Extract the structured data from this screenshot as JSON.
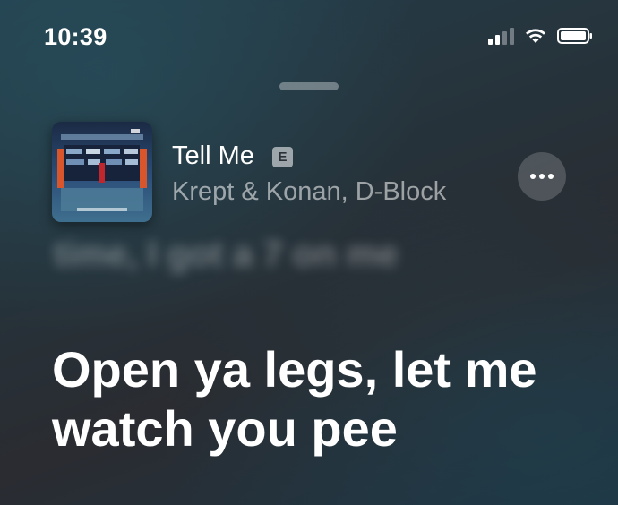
{
  "status_bar": {
    "time": "10:39",
    "signal_icon": "cellular-signal-icon",
    "wifi_icon": "wifi-icon",
    "battery_icon": "battery-icon"
  },
  "now_playing": {
    "title": "Tell Me",
    "explicit_badge": "E",
    "artist": "Krept & Konan, D-Block",
    "more_icon": "more-ellipsis-icon"
  },
  "lyrics": {
    "previous_line": "time, I got a 7 on me",
    "current_line": "Open ya legs, let me watch you pee"
  },
  "colors": {
    "background_top": "#243f4c",
    "background_mid": "#2a2c31",
    "text_primary": "#ffffff"
  }
}
